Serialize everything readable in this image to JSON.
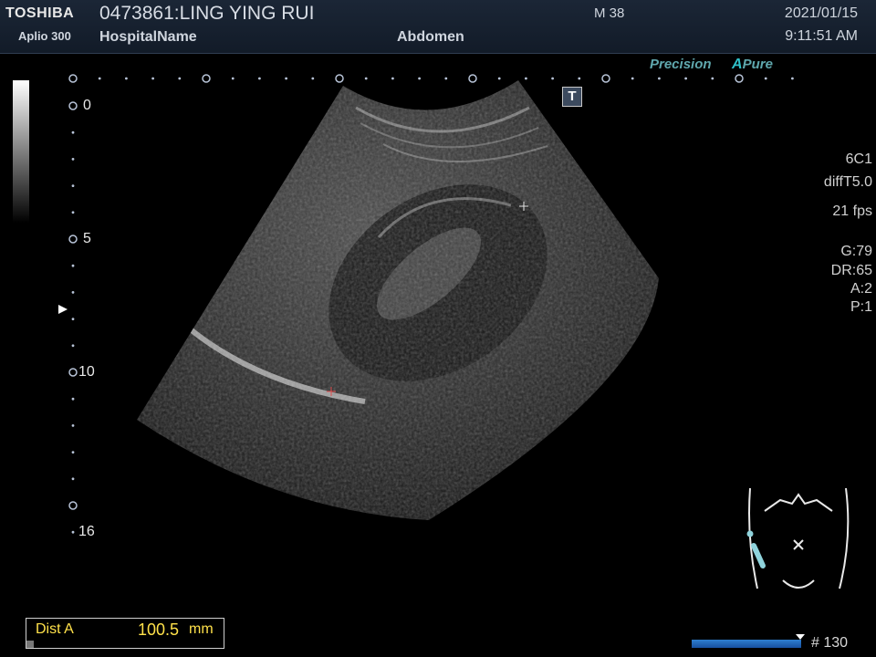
{
  "header": {
    "brand": "TOSHIBA",
    "model": "Aplio 300",
    "patient": "0473861:LING YING RUI",
    "hospital": "HospitalName",
    "exam": "Abdomen",
    "mi": "M 38",
    "date": "2021/01/15",
    "time": "9:11:51 AM"
  },
  "modes": {
    "precision": "Precision",
    "apure_a": "A",
    "apure_rest": "Pure"
  },
  "params": {
    "probe": "6C1",
    "filter": "diffT5.0",
    "fps": "21 fps",
    "gain": "G:79",
    "dr": "DR:65",
    "a": "A:2",
    "p": "P:1"
  },
  "depth": {
    "labels": [
      "0",
      "5",
      "10",
      "16"
    ]
  },
  "body_marker_label": "T",
  "measurement": {
    "label": "Dist A",
    "value": "100.5",
    "unit": "mm"
  },
  "cine": {
    "frame": "# 130"
  },
  "colors": {
    "header_bg": "#121b28",
    "accent_teal": "#5fa7ad",
    "measure_yellow": "#ffe14a",
    "scale_blue": "#2e7fd0"
  }
}
